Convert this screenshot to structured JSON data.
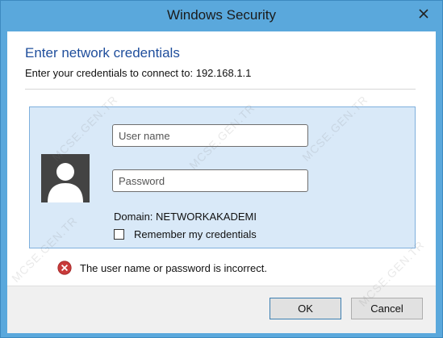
{
  "window": {
    "title": "Windows Security"
  },
  "dialog": {
    "heading": "Enter network credentials",
    "subheading": "Enter your credentials to connect to: 192.168.1.1"
  },
  "credentials": {
    "username_placeholder": "User name",
    "password_placeholder": "Password",
    "domain": "Domain: NETWORKAKADEMI",
    "remember_label": "Remember my credentials",
    "remember_checked": false
  },
  "error": {
    "message": "The user name or password is incorrect."
  },
  "buttons": {
    "ok": "OK",
    "cancel": "Cancel"
  },
  "watermark": {
    "text": "MCSE.GEN.TR"
  },
  "colors": {
    "frame": "#5aa8dc",
    "heading": "#1f4e9c",
    "tile_background": "#d9e9f8",
    "tile_border": "#7fb0dd",
    "error_icon": "#c83a3a"
  },
  "icons": {
    "close": "close-icon",
    "avatar": "user-avatar-icon",
    "error": "error-icon"
  }
}
